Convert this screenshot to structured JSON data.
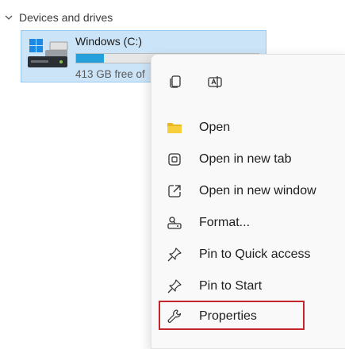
{
  "section": {
    "title": "Devices and drives"
  },
  "drive": {
    "name": "Windows (C:)",
    "free_text": "413 GB free of",
    "used_fraction": 0.15
  },
  "context_menu": {
    "quick_actions": [
      {
        "icon": "copy-icon"
      },
      {
        "icon": "rename-icon"
      }
    ],
    "items": [
      {
        "label": "Open",
        "icon": "folder-icon"
      },
      {
        "label": "Open in new tab",
        "icon": "new-tab-icon"
      },
      {
        "label": "Open in new window",
        "icon": "new-window-icon"
      },
      {
        "label": "Format...",
        "icon": "format-icon"
      },
      {
        "label": "Pin to Quick access",
        "icon": "pin-icon"
      },
      {
        "label": "Pin to Start",
        "icon": "pin-icon"
      },
      {
        "label": "Properties",
        "icon": "wrench-icon"
      }
    ],
    "highlighted_item": "Properties"
  },
  "colors": {
    "drive_tile_bg": "#cce4f7",
    "usage_bar": "#26a0da",
    "highlight_border": "#c4262e",
    "folder_icon": "#e8b820"
  }
}
